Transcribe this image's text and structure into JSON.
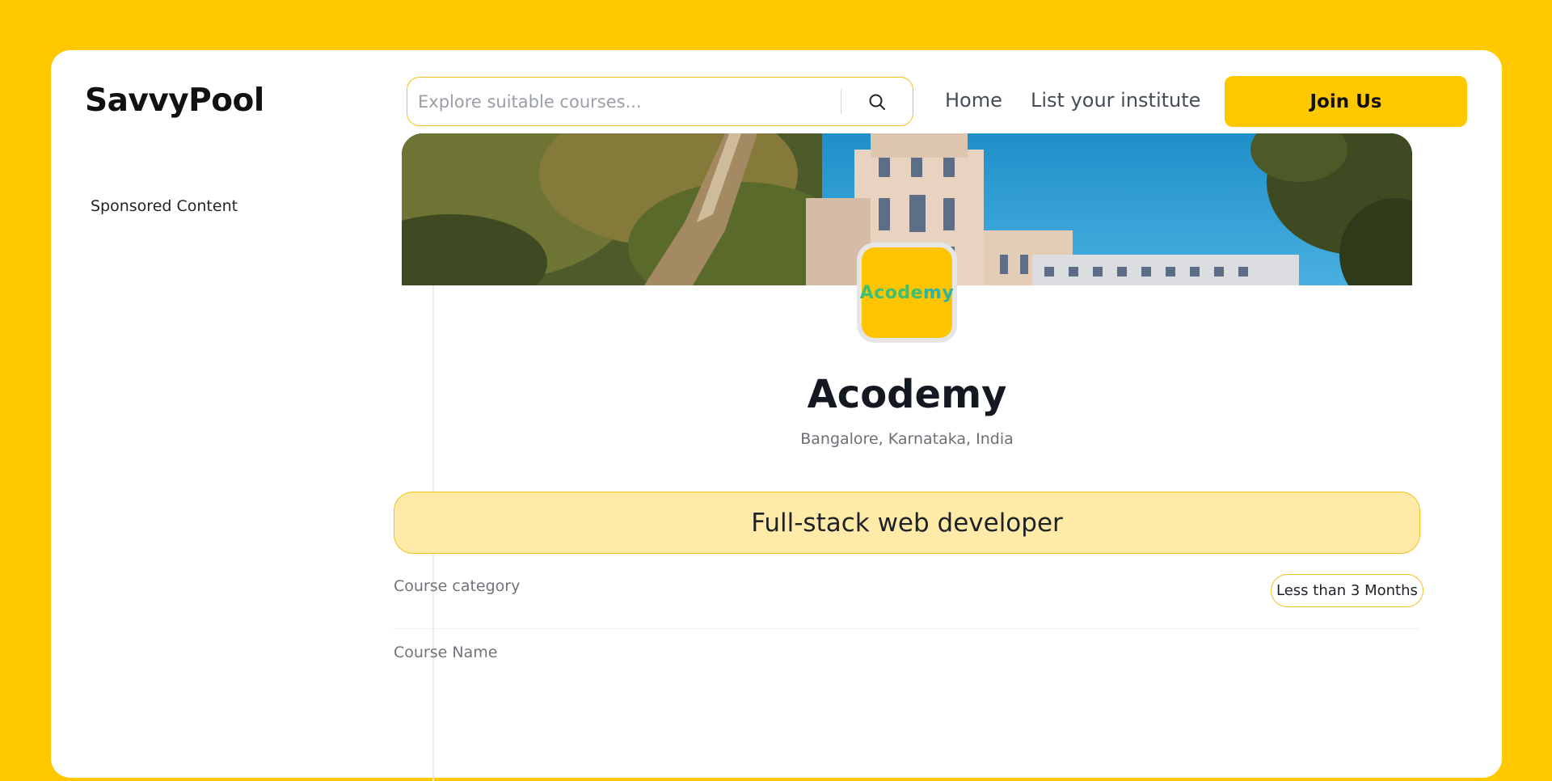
{
  "header": {
    "logo": "SavvyPool",
    "search_placeholder": "Explore suitable courses...",
    "nav": [
      {
        "label": "Home"
      },
      {
        "label": "List your institute"
      }
    ],
    "cta_label": "Join Us"
  },
  "sidebar": {
    "title": "Sponsored Content"
  },
  "institute": {
    "logo_text_part1": "Acode",
    "logo_text_part2": "my",
    "name": "Acodemy",
    "location": "Bangalore, Karnataka, India"
  },
  "course": {
    "title": "Full-stack web developer",
    "fields": [
      {
        "label": "Course category",
        "value": "Less than 3 Months"
      },
      {
        "label": "Course Name"
      }
    ]
  },
  "colors": {
    "page_background": "#ffc800",
    "accent": "#ffc800",
    "accent_border": "#f2c11c",
    "course_box_fill": "#ffeaa8"
  },
  "icons": {
    "search": "search-icon"
  }
}
